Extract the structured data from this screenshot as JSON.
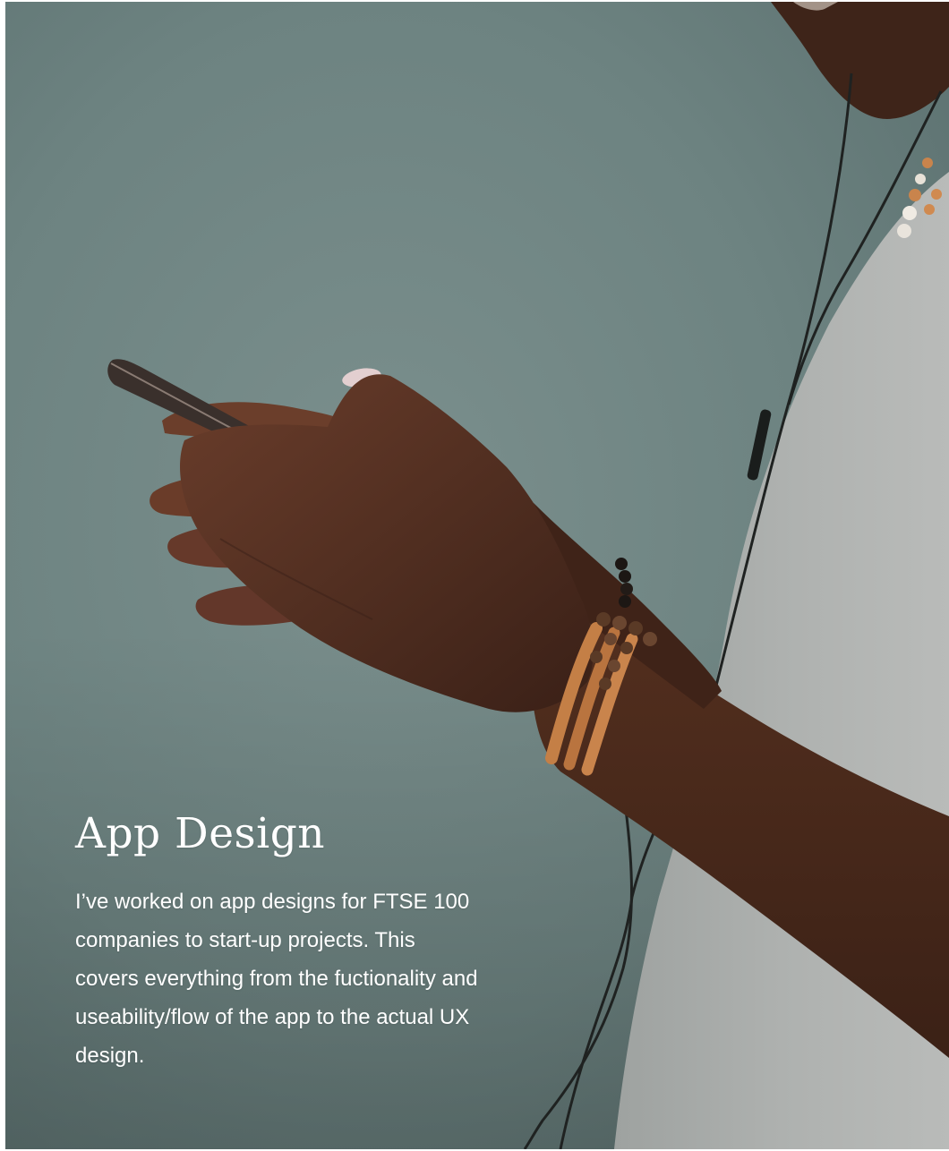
{
  "section": {
    "title": "App Design",
    "description": "I’ve worked on app designs for FTSE 100 companies to start-up projects. This covers everything from the fuctionality and useability/flow of the app to the actual UX design."
  },
  "photo": {
    "background_color": "#6f8583",
    "shirt_color": "#a7aaa8",
    "skin_color": "#4a2b1f",
    "bead_color": "#c9844c"
  }
}
